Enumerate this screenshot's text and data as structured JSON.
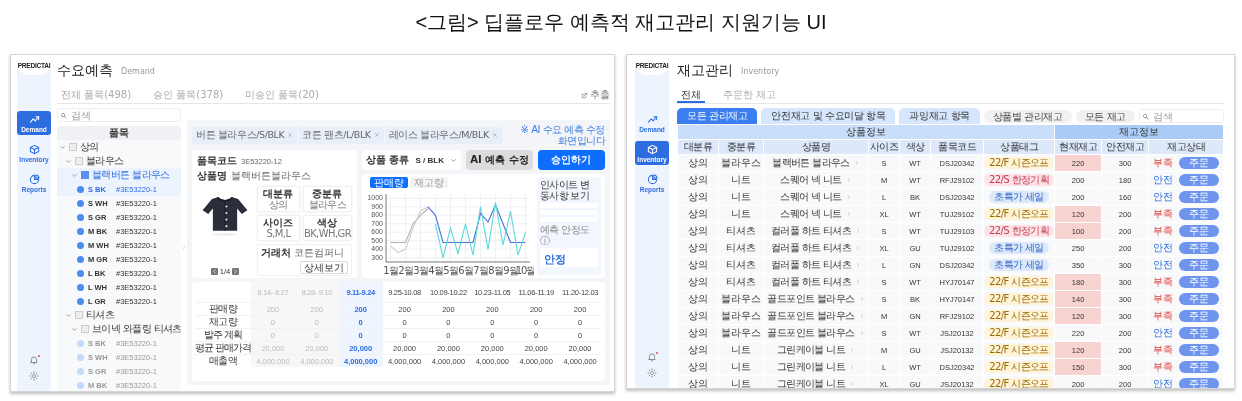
{
  "caption": "<그림> 딥플로우 예측적 재고관리 지원기능 UI",
  "demand_screen": {
    "logo": "PREDICTAI",
    "sidebar": [
      {
        "label": "Demand",
        "selected": true
      },
      {
        "label": "Inventory",
        "selected": false
      },
      {
        "label": "Reports",
        "selected": false
      }
    ],
    "title": "수요예측",
    "subtitle": "Demand",
    "tabs": [
      {
        "label": "전체 품목(498)",
        "selected": false
      },
      {
        "label": "승인 품목(378)",
        "selected": false
      },
      {
        "label": "미승인 품목(20)",
        "selected": false
      }
    ],
    "export_label": "추출",
    "search": {
      "placeholder": "검색"
    },
    "tree_header": "품목",
    "tree": [
      {
        "label": "상의",
        "expanded": true,
        "children": [
          {
            "label": "블라우스",
            "expanded": true,
            "children": [
              {
                "label": "블랙버튼 블라우스",
                "expanded": true,
                "selected": true,
                "children": [
                  {
                    "option": "S BK",
                    "code": "#3E53220-1",
                    "selected": true
                  },
                  {
                    "option": "S WH",
                    "code": "#3E53220-1",
                    "selected": false
                  },
                  {
                    "option": "S GR",
                    "code": "#3E53220-1",
                    "selected": false
                  },
                  {
                    "option": "M BK",
                    "code": "#3E53220-1",
                    "selected": false
                  },
                  {
                    "option": "M WH",
                    "code": "#3E53220-1",
                    "selected": false
                  },
                  {
                    "option": "M GR",
                    "code": "#3E53220-1",
                    "selected": false
                  },
                  {
                    "option": "L BK",
                    "code": "#3E53220-1",
                    "selected": false
                  },
                  {
                    "option": "L WH",
                    "code": "#3E53220-1",
                    "selected": false
                  },
                  {
                    "option": "L GR",
                    "code": "#3E53220-1",
                    "selected": false
                  }
                ]
              }
            ]
          },
          {
            "label": "티셔츠",
            "expanded": true,
            "children": [
              {
                "label": "브이넥 와플링 티셔츠",
                "expanded": true,
                "selected": false,
                "children": [
                  {
                    "option": "S BK",
                    "code": "#3E53220-1",
                    "selected": false
                  },
                  {
                    "option": "S WH",
                    "code": "#3E53220-1",
                    "selected": false
                  },
                  {
                    "option": "S GR",
                    "code": "#3E53220-1",
                    "selected": false
                  },
                  {
                    "option": "M BK",
                    "code": "#3E53220-1",
                    "selected": false
                  }
                ]
              }
            ]
          }
        ]
      }
    ],
    "open_tabs": [
      {
        "label": "버튼 블라우스/S/BLK",
        "selected": false
      },
      {
        "label": "코튼 팬츠/L/BLK",
        "selected": false
      },
      {
        "label": "레이스 블라우스/M/BLK",
        "selected": false
      }
    ],
    "note": "※ AI 수요 예측 수정 화면입니다",
    "product": {
      "code_label": "품목코드",
      "code": "3E53220-12",
      "name_label": "상품명",
      "name": "블랙버튼블라우스",
      "attributes": [
        {
          "label": "대분류",
          "value": "상의"
        },
        {
          "label": "중분류",
          "value": "블라우스"
        },
        {
          "label": "사이즈",
          "value": "S,M,L"
        },
        {
          "label": "색상",
          "value": "BK,WH,GR"
        }
      ],
      "page": "1/4",
      "vendor_label": "거래처",
      "vendor": "코튼컴퍼니",
      "detail_button": "상세보기"
    },
    "variant": {
      "label": "상품 종류",
      "value": "S / BLK"
    },
    "buttons": [
      {
        "label": "AI 예측 수정",
        "kind": "secondary"
      },
      {
        "label": "승인하기",
        "kind": "primary"
      }
    ],
    "chart_tabs": [
      {
        "label": "판매량",
        "selected": true
      },
      {
        "label": "재고량",
        "selected": false
      }
    ],
    "chart_data": {
      "type": "line",
      "x": [
        1,
        1.5,
        2,
        2.5,
        3,
        3.5,
        4,
        4.5,
        5,
        5.5,
        6,
        6.5,
        7,
        7.5,
        8,
        8.5,
        9,
        9.5,
        10
      ],
      "series": [
        {
          "color": "#b4b4b4",
          "values": [
            480,
            480,
            480,
            700,
            800,
            880,
            null,
            null,
            null,
            null,
            null,
            null,
            null,
            null,
            null,
            null,
            null,
            null,
            null
          ]
        },
        {
          "color": "#cfcfcf",
          "values": [
            440,
            360,
            400,
            650,
            850,
            900,
            null,
            null,
            null,
            null,
            null,
            null,
            null,
            null,
            null,
            null,
            null,
            null,
            null
          ]
        },
        {
          "color": "#4a72d4",
          "values": [
            null,
            null,
            null,
            null,
            null,
            900,
            800,
            480,
            480,
            480,
            480,
            480,
            820,
            720,
            920,
            700,
            480,
            480,
            480
          ]
        },
        {
          "color": "#5ed8d8",
          "values": [
            null,
            null,
            null,
            null,
            null,
            null,
            700,
            300,
            650,
            350,
            700,
            330,
            900,
            400,
            950,
            450,
            850,
            330,
            600
          ]
        }
      ],
      "xlim": [
        0.7,
        10.3
      ],
      "ylim": [
        250,
        1050
      ],
      "yticks": [
        300,
        400,
        500,
        600,
        700,
        800,
        900,
        1000
      ],
      "xticks": [
        {
          "value": 1,
          "label": "1월"
        },
        {
          "value": 2,
          "label": "2월"
        },
        {
          "value": 3,
          "label": "3월"
        },
        {
          "value": 4,
          "label": "4월"
        },
        {
          "value": 5,
          "label": "5월"
        },
        {
          "value": 6,
          "label": "6월"
        },
        {
          "value": 7,
          "label": "7월"
        },
        {
          "value": 8,
          "label": "8월"
        },
        {
          "value": 9,
          "label": "9월"
        },
        {
          "value": 10,
          "label": "10월"
        }
      ],
      "grid": true
    },
    "insight_title": "인사이트 변동사항 보기",
    "stability": {
      "label": "예측 안정도 ⓘ",
      "value": "안정"
    },
    "forecast_table": {
      "periods": [
        {
          "label": "8.14- 8.27",
          "past": true,
          "selected": false
        },
        {
          "label": "8.28- 9.10",
          "past": true,
          "selected": false
        },
        {
          "label": "9.11-9.24",
          "past": false,
          "selected": true
        },
        {
          "label": "9.25-10.08",
          "past": false,
          "selected": false
        },
        {
          "label": "10.09-10.22",
          "past": false,
          "selected": false
        },
        {
          "label": "10.23-11.05",
          "past": false,
          "selected": false
        },
        {
          "label": "11.06-11.19",
          "past": false,
          "selected": false
        },
        {
          "label": "11.20-12.03",
          "past": false,
          "selected": false
        }
      ],
      "rows": [
        {
          "label": "판매량",
          "values": [
            "200",
            "200",
            "200",
            "200",
            "200",
            "200",
            "200",
            "200"
          ]
        },
        {
          "label": "재고량",
          "values": [
            "0",
            "0",
            "0",
            "0",
            "0",
            "0",
            "0",
            "0"
          ]
        },
        {
          "label": "발주 계획",
          "values": [
            "0",
            "0",
            "0",
            "0",
            "0",
            "0",
            "0",
            "0"
          ]
        },
        {
          "label": "평균 판매가격",
          "values": [
            "20,000",
            "20,000",
            "20,000",
            "20,000",
            "20,000",
            "20,000",
            "20,000",
            "20,000"
          ]
        },
        {
          "label": "매출액",
          "values": [
            "4,000,000",
            "4,000,000",
            "4,000,000",
            "4,000,000",
            "4,000,000",
            "4,000,000",
            "4,000,000",
            "4,000,000"
          ]
        }
      ]
    }
  },
  "inventory_screen": {
    "logo": "PREDICTAI",
    "sidebar": [
      {
        "label": "Demand",
        "selected": false
      },
      {
        "label": "Inventory",
        "selected": true
      },
      {
        "label": "Reports",
        "selected": false
      }
    ],
    "title": "재고관리",
    "subtitle": "Inventory",
    "tabs": [
      {
        "label": "전체",
        "selected": true
      },
      {
        "label": "주문한 재고",
        "selected": false
      }
    ],
    "filters": [
      {
        "label": "모든 관리재고",
        "kind": "tab",
        "selected": true
      },
      {
        "label": "안전재고 및 수요미달 항목",
        "kind": "tab",
        "selected": false
      },
      {
        "label": "과잉재고 항목",
        "kind": "tab",
        "selected": false
      },
      {
        "label": "상품별 관리재고",
        "kind": "chip",
        "selected": false
      },
      {
        "label": "모든 재고",
        "kind": "chip",
        "selected": false
      }
    ],
    "search": {
      "placeholder": "검색"
    },
    "column_groups": [
      {
        "label": "상품정보",
        "columns": [
          "대분류",
          "중분류",
          "상품명",
          "사이즈",
          "색상",
          "품목코드",
          "상품태그"
        ]
      },
      {
        "label": "재고정보",
        "columns": [
          "현재재고",
          "안전재고",
          "재고상태"
        ]
      }
    ],
    "rows": [
      {
        "category": "상의",
        "subcategory": "블라우스",
        "product": "블랙버튼 블라우스",
        "size": "S",
        "shade": "WT",
        "code": "DSJ20342",
        "tag": {
          "label": "22/F 시즌오프",
          "kind": "season"
        },
        "current": "220",
        "safety": "300",
        "status": "부족",
        "shortage": true,
        "action": "주문"
      },
      {
        "category": "상의",
        "subcategory": "니트",
        "product": "스퀘어 넥 니트",
        "size": "M",
        "shade": "WT",
        "code": "RFJ29102",
        "tag": {
          "label": "22/S 한정기획",
          "kind": "limited"
        },
        "current": "200",
        "safety": "180",
        "status": "안전",
        "shortage": false,
        "action": "주문"
      },
      {
        "category": "상의",
        "subcategory": "니트",
        "product": "스퀘어 넥 니트",
        "size": "L",
        "shade": "BK",
        "code": "DSJ20342",
        "tag": {
          "label": "초특가 세일",
          "kind": "sale"
        },
        "current": "200",
        "safety": "160",
        "status": "안전",
        "shortage": false,
        "action": "주문"
      },
      {
        "category": "상의",
        "subcategory": "니트",
        "product": "스퀘어 넥 니트",
        "size": "XL",
        "shade": "WT",
        "code": "TUJ29102",
        "tag": {
          "label": "22/F 시즌오프",
          "kind": "season"
        },
        "current": "120",
        "safety": "200",
        "status": "부족",
        "shortage": true,
        "action": "주문"
      },
      {
        "category": "상의",
        "subcategory": "티셔츠",
        "product": "컬러풀 하트 티셔츠",
        "size": "S",
        "shade": "WT",
        "code": "TUJ29103",
        "tag": {
          "label": "22/S 한정기획",
          "kind": "limited"
        },
        "current": "100",
        "safety": "200",
        "status": "부족",
        "shortage": true,
        "action": "주문"
      },
      {
        "category": "상의",
        "subcategory": "티셔츠",
        "product": "컬러풀 하트 티셔츠",
        "size": "XL",
        "shade": "GU",
        "code": "TUJ29102",
        "tag": {
          "label": "초특가 세일",
          "kind": "sale"
        },
        "current": "250",
        "safety": "200",
        "status": "안전",
        "shortage": false,
        "action": "주문"
      },
      {
        "category": "상의",
        "subcategory": "티셔츠",
        "product": "컬러풀 하트 티셔츠",
        "size": "L",
        "shade": "GN",
        "code": "DSJ20342",
        "tag": {
          "label": "초특가 세일",
          "kind": "sale"
        },
        "current": "350",
        "safety": "300",
        "status": "안전",
        "shortage": false,
        "action": "주문"
      },
      {
        "category": "상의",
        "subcategory": "티셔츠",
        "product": "컬러풀 하트 티셔츠",
        "size": "S",
        "shade": "WT",
        "code": "HYJ70147",
        "tag": {
          "label": "22/F 시즌오프",
          "kind": "season"
        },
        "current": "180",
        "safety": "300",
        "status": "부족",
        "shortage": true,
        "action": "주문"
      },
      {
        "category": "상의",
        "subcategory": "블라우스",
        "product": "골드포인트 블라우스",
        "size": "S",
        "shade": "BK",
        "code": "HYJ70147",
        "tag": {
          "label": "22/F 시즌오프",
          "kind": "season"
        },
        "current": "140",
        "safety": "300",
        "status": "부족",
        "shortage": true,
        "action": "주문"
      },
      {
        "category": "상의",
        "subcategory": "블라우스",
        "product": "골드포인트 블라우스",
        "size": "M",
        "shade": "GN",
        "code": "RFJ29102",
        "tag": {
          "label": "22/F 시즌오프",
          "kind": "season"
        },
        "current": "120",
        "safety": "300",
        "status": "부족",
        "shortage": true,
        "action": "주문"
      },
      {
        "category": "상의",
        "subcategory": "블라우스",
        "product": "골드포인트 블라우스",
        "size": "S",
        "shade": "WT",
        "code": "JSJ20132",
        "tag": {
          "label": "22/F 시즌오프",
          "kind": "season"
        },
        "current": "220",
        "safety": "200",
        "status": "안전",
        "shortage": false,
        "action": "주문"
      },
      {
        "category": "상의",
        "subcategory": "니트",
        "product": "그린케이블 니트",
        "size": "M",
        "shade": "GU",
        "code": "JSJ20132",
        "tag": {
          "label": "22/F 시즌오프",
          "kind": "season"
        },
        "current": "120",
        "safety": "200",
        "status": "부족",
        "shortage": true,
        "action": "주문"
      },
      {
        "category": "상의",
        "subcategory": "니트",
        "product": "그린케이블 니트",
        "size": "L",
        "shade": "WT",
        "code": "DSJ20342",
        "tag": {
          "label": "22/F 시즌오프",
          "kind": "season"
        },
        "current": "150",
        "safety": "300",
        "status": "부족",
        "shortage": true,
        "action": "주문"
      },
      {
        "category": "상의",
        "subcategory": "니트",
        "product": "그린케이블 니트",
        "size": "XL",
        "shade": "GU",
        "code": "JSJ20132",
        "tag": {
          "label": "22/F 시즌오프",
          "kind": "season"
        },
        "current": "200",
        "safety": "200",
        "status": "안전",
        "shortage": false,
        "action": "주문"
      }
    ]
  }
}
